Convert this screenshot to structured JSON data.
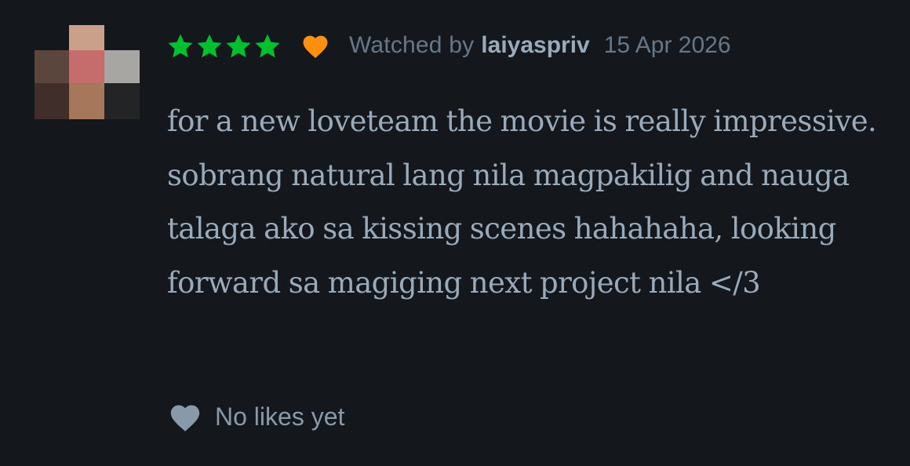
{
  "review": {
    "rating_stars": 4,
    "rating_max": 5,
    "liked": true,
    "watched_prefix": "Watched by",
    "username": "laiyaspriv",
    "date": "15 Apr 2026",
    "text": "for a new loveteam the movie is really impressive. sobrang natural lang nila magpakilig and nauga talaga ako sa kissing scenes hahahaha, looking forward sa magiging next project nila </3",
    "likes_label": "No likes yet"
  },
  "icons": {
    "avatar": "user-avatar-pixelated",
    "rating": "star-icon",
    "liked": "heart-icon",
    "likes": "heart-icon"
  },
  "colors": {
    "background": "#14181c",
    "star": "#00c030",
    "liked_heart": "#ff9010",
    "meta_text": "#667788",
    "username": "#99aabb",
    "review_text": "#99aabb",
    "likes_heart": "#8899aa"
  }
}
